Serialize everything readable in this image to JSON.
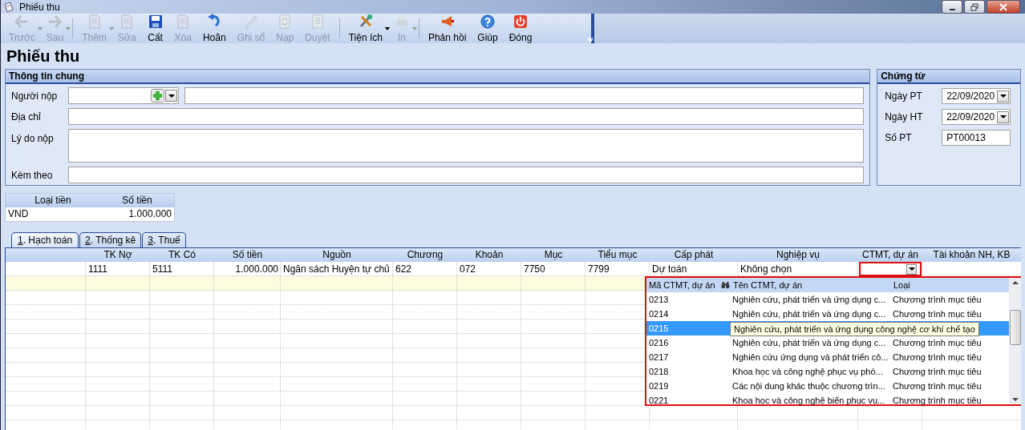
{
  "window": {
    "title": "Phiếu thu"
  },
  "toolbar": [
    {
      "label": "Trước",
      "kind": "left",
      "disabled": true,
      "dropdown": true
    },
    {
      "label": "Sau",
      "kind": "right",
      "disabled": true,
      "dropdown": true
    },
    {
      "label": "Thêm",
      "kind": "add",
      "disabled": true,
      "dropdown": true
    },
    {
      "label": "Sửa",
      "kind": "edit",
      "disabled": true,
      "dropdown": false
    },
    {
      "label": "Cất",
      "kind": "save",
      "disabled": false,
      "dropdown": false
    },
    {
      "label": "Xóa",
      "kind": "delete",
      "disabled": true,
      "dropdown": false
    },
    {
      "label": "Hoãn",
      "kind": "undo",
      "disabled": false,
      "dropdown": false
    },
    {
      "label": "Ghi sổ",
      "kind": "pencil",
      "disabled": true,
      "dropdown": false
    },
    {
      "label": "Nạp",
      "kind": "reload",
      "disabled": true,
      "dropdown": false
    },
    {
      "label": "Duyệt",
      "kind": "list",
      "disabled": true,
      "dropdown": false
    },
    {
      "label": "Tiện ích",
      "kind": "tools",
      "disabled": false,
      "dropdown": true
    },
    {
      "label": "In",
      "kind": "print",
      "disabled": true,
      "dropdown": true
    },
    {
      "label": "Phản hồi",
      "kind": "megaphone",
      "disabled": false,
      "dropdown": false
    },
    {
      "label": "Giúp",
      "kind": "help",
      "disabled": false,
      "dropdown": false
    },
    {
      "label": "Đóng",
      "kind": "power",
      "disabled": false,
      "dropdown": false
    }
  ],
  "heading": "Phiếu thu",
  "general": {
    "title": "Thông tin chung",
    "payer_label": "Người nộp",
    "address_label": "Địa chỉ",
    "reason_label": "Lý do nộp",
    "attach_label": "Kèm theo"
  },
  "voucher": {
    "title": "Chứng từ",
    "fields": [
      {
        "label": "Ngày PT",
        "value": "22/09/2020",
        "kind": "date"
      },
      {
        "label": "Ngày HT",
        "value": "22/09/2020",
        "kind": "date"
      },
      {
        "label": "Số PT",
        "value": "PT00013",
        "kind": "text"
      }
    ]
  },
  "currency": {
    "columns": [
      "Loại tiền",
      "Số tiền"
    ],
    "rows": [
      [
        "VND",
        "1.000.000"
      ]
    ]
  },
  "tabs": [
    {
      "hotkey": "1",
      "label": ". Hạch toán",
      "selected": true
    },
    {
      "hotkey": "2",
      "label": ". Thống kê",
      "selected": false
    },
    {
      "hotkey": "3",
      "label": ". Thuế",
      "selected": false
    }
  ],
  "grid": {
    "columns": [
      "TK Nợ",
      "TK Có",
      "Số tiền",
      "Nguồn",
      "Chương",
      "Khoản",
      "Mục",
      "Tiểu mục",
      "Cấp phát",
      "Nghiệp vụ",
      "CTMT, dự án",
      "Tài khoản NH, KB"
    ],
    "rows": [
      {
        "values": [
          "1111",
          "5111",
          "1.000.000",
          "Ngân sách Huyện tự chủ",
          "622",
          "072",
          "7750",
          "7799",
          "Dự toán",
          "Không chọn"
        ],
        "ctmt_open": true
      }
    ]
  },
  "dropdown": {
    "columns": [
      "Mã CTMT, dự án",
      "Tên CTMT, dự án",
      "Loại"
    ],
    "rows": [
      {
        "code": "0213",
        "name": "Nghiên cứu, phát triển và ứng dụng c...",
        "type": "Chương trình mục tiêu",
        "selected": false
      },
      {
        "code": "0214",
        "name": "Nghiên cứu, phát triển và ứng dụng c...",
        "type": "Chương trình mục tiêu",
        "selected": false
      },
      {
        "code": "0215",
        "selected": true,
        "tooltip": "Nghiên cứu, phát triển và ứng dụng công nghệ cơ khí chế tạo"
      },
      {
        "code": "0216",
        "name": "Nghiên cứu, phát triển và ứng dụng c...",
        "type": "Chương trình mục tiêu",
        "selected": false
      },
      {
        "code": "0217",
        "name": "Nghiên cứu ứng dụng và phát triển cô...",
        "type": "Chương trình mục tiêu",
        "selected": false
      },
      {
        "code": "0218",
        "name": "Khoa học và công nghệ phục vụ phò...",
        "type": "Chương trình mục tiêu",
        "selected": false
      },
      {
        "code": "0219",
        "name": "Các nội dung khác thuộc chương trìn...",
        "type": "Chương trình mục tiêu",
        "selected": false
      },
      {
        "code": "0221",
        "name": "Khoa học và công nghệ biển phục vụ...",
        "type": "Chương trình mục tiêu",
        "selected": false
      }
    ]
  }
}
